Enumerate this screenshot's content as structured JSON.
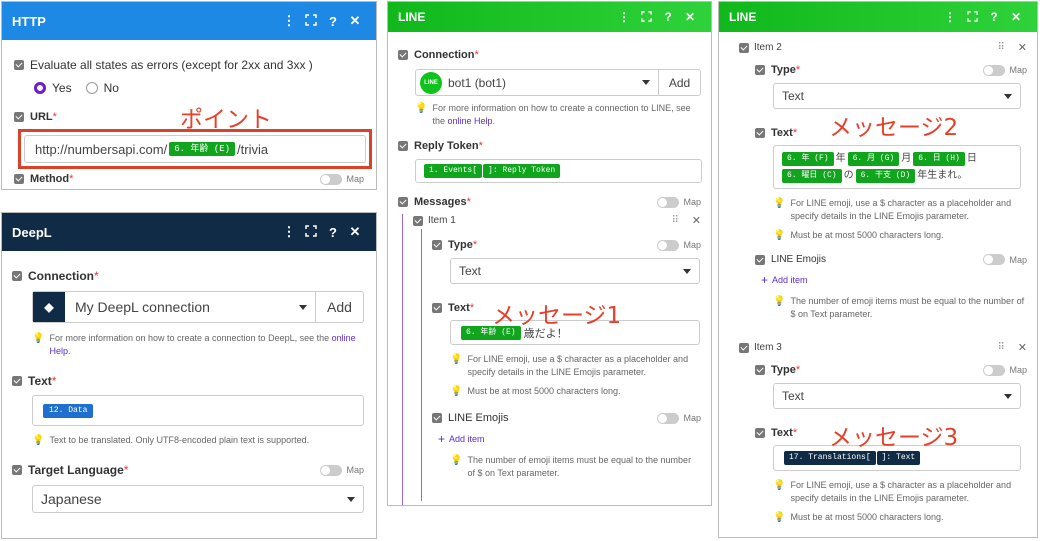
{
  "http": {
    "title": "HTTP",
    "evaluate_label": "Evaluate all states as errors (except for 2xx and 3xx )",
    "yes": "Yes",
    "no": "No",
    "url_label": "URL",
    "url_prefix": "http://numbersapi.com/",
    "url_pill": "6. 年齢 (E)",
    "url_suffix": "/trivia",
    "method_label": "Method",
    "map": "Map",
    "annotation": "ポイント"
  },
  "deepl": {
    "title": "DeepL",
    "connection_label": "Connection",
    "connection_value": "My DeepL connection",
    "add": "Add",
    "help1": "For more information on how to create a connection to DeepL, see the ",
    "help_link": "online Help",
    "help_end": ".",
    "text_label": "Text",
    "text_pill": "12. Data",
    "text_help": "Text to be translated. Only UTF8-encoded plain text is supported.",
    "target_label": "Target Language",
    "target_value": "Japanese",
    "map": "Map"
  },
  "line1": {
    "title": "LINE",
    "connection_label": "Connection",
    "connection_value": "bot1 (bot1)",
    "add": "Add",
    "help1": "For more information on how to create a connection to LINE, see the ",
    "help_link": "online Help",
    "help_end": ".",
    "reply_label": "Reply Token",
    "reply_pill1": "1. Events[",
    "reply_pill2": "]: Reply Token",
    "messages_label": "Messages",
    "map": "Map",
    "item1": "Item 1",
    "type_label": "Type",
    "type_value": "Text",
    "text_label": "Text",
    "text_pill": "6. 年齢 (E)",
    "text_suffix": "歳だよ！",
    "emoji_help1": "For LINE emoji, use a $ character as a placeholder and specify details in the LINE Emojis parameter.",
    "max_help": "Must be at most 5000 characters long.",
    "emojis_label": "LINE Emojis",
    "add_item": "Add item",
    "emoji_count_help": "The number of emoji items must be equal to the number of $ on Text parameter.",
    "annotation": "メッセージ1"
  },
  "line2": {
    "title": "LINE",
    "item2": "Item 2",
    "item3": "Item 3",
    "type_label": "Type",
    "type_value": "Text",
    "map": "Map",
    "text_label": "Text",
    "p_year": "6. 年 (F)",
    "s_year": "年",
    "p_month": "6. 月 (G)",
    "s_month": "月",
    "p_day": "6. 日 (H)",
    "s_day": "日",
    "p_weekday": "6. 曜日 (C)",
    "s_no": "の",
    "p_zodiac": "6. 干支 (D)",
    "s_born": "年生まれ。",
    "emoji_help": "For LINE emoji, use a $ character as a placeholder and specify details in the LINE Emojis parameter.",
    "max_help": "Must be at most 5000 characters long.",
    "emojis_label": "LINE Emojis",
    "add_item": "Add item",
    "emoji_count_help": "The number of emoji items must be equal to the number of $ on Text parameter.",
    "text3_pill1": "17. Translations[",
    "text3_pill2": "]: Text",
    "annotation2": "メッセージ2",
    "annotation3": "メッセージ3"
  },
  "icons": {
    "menu": "⋮",
    "expand": "⛶",
    "help": "?",
    "close": "✕"
  }
}
